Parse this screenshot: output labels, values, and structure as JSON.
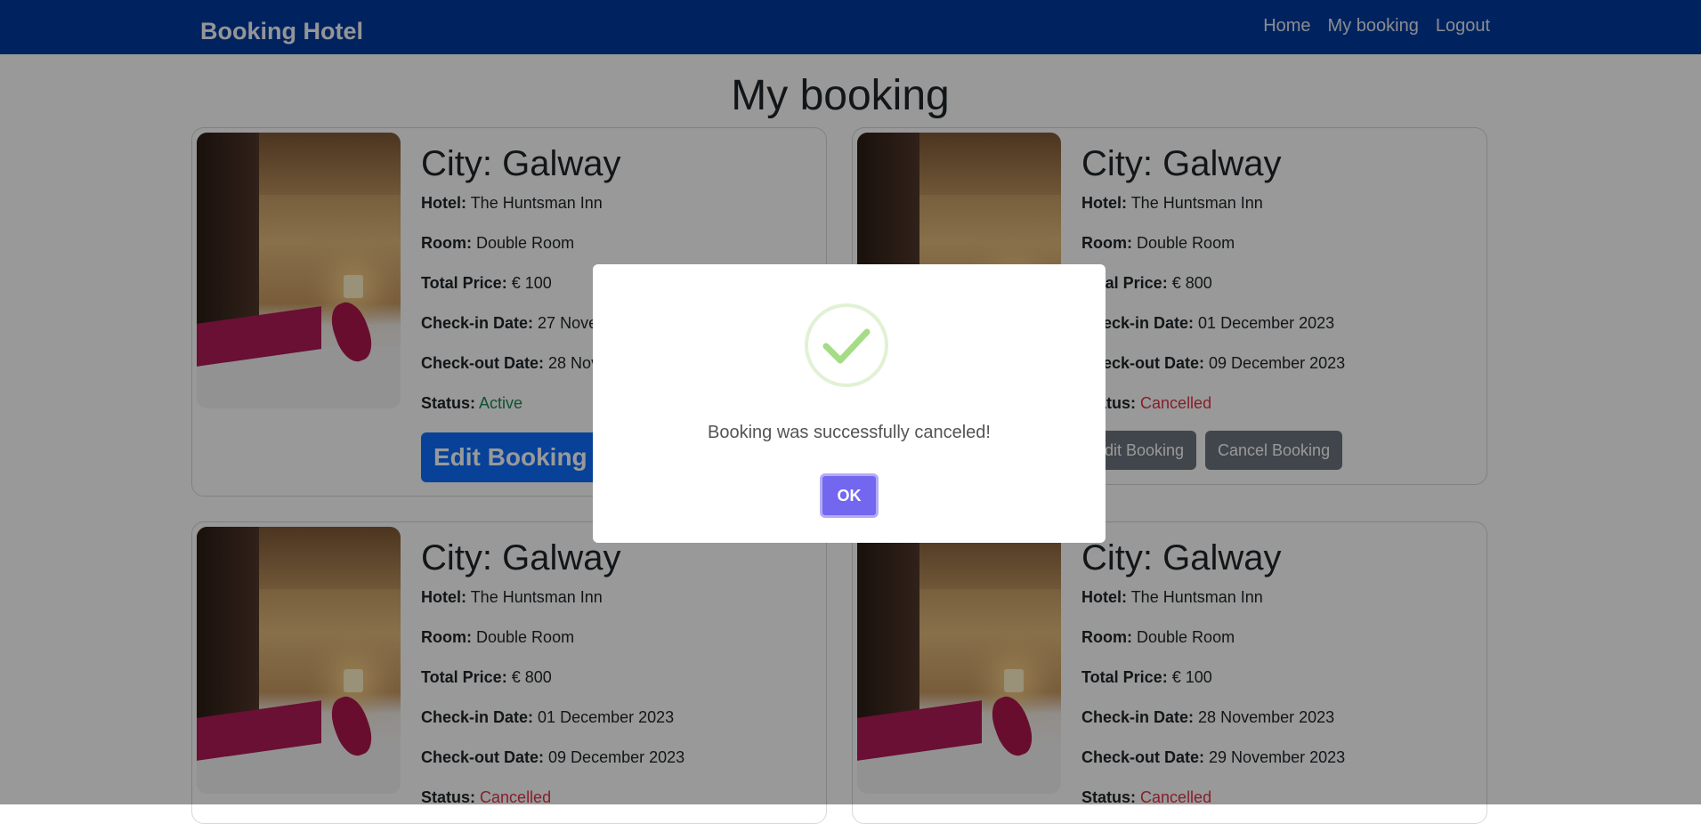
{
  "nav": {
    "brand": "Booking Hotel",
    "links": [
      "Home",
      "My booking",
      "Logout"
    ]
  },
  "page": {
    "title": "My booking"
  },
  "labels": {
    "city_prefix": "City:",
    "hotel": "Hotel:",
    "room": "Room:",
    "total_price": "Total Price:",
    "checkin": "Check-in Date:",
    "checkout": "Check-out Date:",
    "status": "Status:"
  },
  "bookings": [
    {
      "city": "City: Galway",
      "hotel": "The Huntsman Inn",
      "room": "Double Room",
      "total_price": "€ 100",
      "checkin": "27 Nove",
      "checkout": "28 Nov",
      "status": "Active",
      "edit_label": "Edit Booking"
    },
    {
      "city": "City: Galway",
      "hotel": "The Huntsman Inn",
      "room": "Double Room",
      "total_price": "€ 800",
      "checkin": "01 December 2023",
      "checkout": "09 December 2023",
      "status": "Cancelled",
      "edit_label": "Edit Booking",
      "cancel_label": "Cancel Booking"
    },
    {
      "city": "City: Galway",
      "hotel": "The Huntsman Inn",
      "room": "Double Room",
      "total_price": "€ 800",
      "checkin": "01 December 2023",
      "checkout": "09 December 2023",
      "status": "Cancelled"
    },
    {
      "city": "City: Galway",
      "hotel": "The Huntsman Inn",
      "room": "Double Room",
      "total_price": "€ 100",
      "checkin": "28 November 2023",
      "checkout": "29 November 2023",
      "status": "Cancelled"
    }
  ],
  "modal": {
    "message": "Booking was successfully canceled!",
    "ok_label": "OK",
    "icon": "success-check-icon"
  },
  "colors": {
    "navbar": "#013b9e",
    "primary": "#0d6efd",
    "secondary": "#6c757d",
    "active": "#198754",
    "cancelled": "#dc3545",
    "modal_button": "#7367f0",
    "success_icon": "#a5dc86"
  }
}
